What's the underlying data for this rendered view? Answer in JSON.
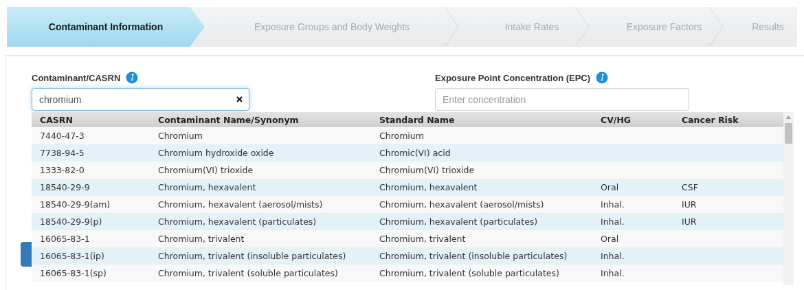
{
  "steps": [
    {
      "label": "Contaminant Information",
      "selected": true
    },
    {
      "label": "Exposure Groups and Body Weights",
      "selected": false
    },
    {
      "label": "Intake Rates",
      "selected": false
    },
    {
      "label": "Exposure Factors",
      "selected": false
    },
    {
      "label": "Results",
      "selected": false
    }
  ],
  "contaminant_field": {
    "label": "Contaminant/CASRN",
    "value": "chromium"
  },
  "epc_field": {
    "label": "Exposure Point Concentration (EPC)",
    "placeholder": "Enter concentration"
  },
  "table": {
    "columns": [
      "CASRN",
      "Contaminant Name/Synonym",
      "Standard Name",
      "CV/HG",
      "Cancer Risk"
    ],
    "rows": [
      [
        "7440-47-3",
        "Chromium",
        "Chromium",
        "",
        ""
      ],
      [
        "7738-94-5",
        "Chromium hydroxide oxide",
        "Chromic(VI) acid",
        "",
        ""
      ],
      [
        "1333-82-0",
        "Chromium(VI) trioxide",
        "Chromium(VI) trioxide",
        "",
        ""
      ],
      [
        "18540-29-9",
        "Chromium, hexavalent",
        "Chromium, hexavalent",
        "Oral",
        "CSF"
      ],
      [
        "18540-29-9(am)",
        "Chromium, hexavalent (aerosol/mists)",
        "Chromium, hexavalent (aerosol/mists)",
        "Inhal.",
        "IUR"
      ],
      [
        "18540-29-9(p)",
        "Chromium, hexavalent (particulates)",
        "Chromium, hexavalent (particulates)",
        "Inhal.",
        "IUR"
      ],
      [
        "16065-83-1",
        "Chromium, trivalent",
        "Chromium, trivalent",
        "Oral",
        ""
      ],
      [
        "16065-83-1(ip)",
        "Chromium, trivalent (insoluble particulates)",
        "Chromium, trivalent (insoluble particulates)",
        "Inhal.",
        ""
      ],
      [
        "16065-83-1(sp)",
        "Chromium, trivalent (soluble particulates)",
        "Chromium, trivalent (soluble particulates)",
        "Inhal.",
        ""
      ]
    ]
  }
}
